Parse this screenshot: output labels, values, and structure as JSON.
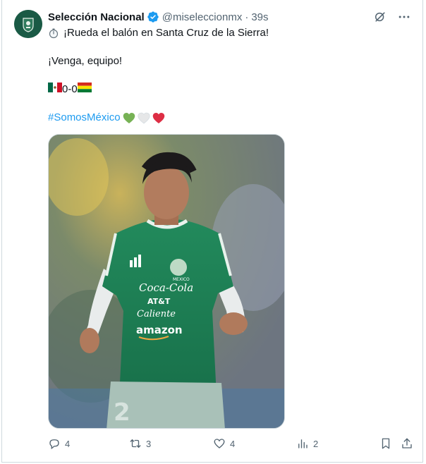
{
  "author": {
    "name": "Selección Nacional",
    "handle": "@miseleccionmx",
    "separator": "·",
    "time": "39s"
  },
  "body": {
    "line1": "¡Rueda el balón en Santa Cruz de la Sierra!",
    "line2": "¡Venga, equipo!",
    "score": "0-0",
    "hashtag": "#SomosMéxico"
  },
  "media": {
    "jersey_sponsors": [
      "Coca-Cola",
      "AT&T",
      "Caliente",
      "amazon"
    ],
    "jersey_crest": "MEXICO",
    "jersey_number": "2"
  },
  "actions": {
    "replies": "4",
    "reposts": "3",
    "likes": "4",
    "views": "2"
  },
  "colors": {
    "accent": "#1d9bf0",
    "muted": "#536471",
    "jersey_green": "#1e7a52"
  }
}
